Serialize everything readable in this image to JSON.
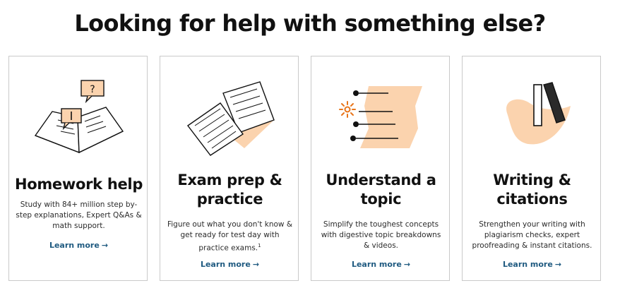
{
  "page": {
    "title": "Looking for help with something else?"
  },
  "cards": [
    {
      "title": "Homework help",
      "description": "Study with 84+ million step by-step explanations, Expert Q&As & math support.",
      "link": "Learn more",
      "icon": "open-book-question-icon"
    },
    {
      "title": "Exam prep & practice",
      "description": "Figure out what you don't know & get ready for test day with practice exams.",
      "footnote": "1",
      "link": "Learn more",
      "icon": "exam-papers-icon"
    },
    {
      "title": "Understand a topic",
      "description": "Simplify the toughest concepts with digestive topic breakdowns & videos.",
      "link": "Learn more",
      "icon": "topic-list-icon"
    },
    {
      "title": "Writing & citations",
      "description": "Strengthen your writing with plagiarism checks, expert proofreading & instant citations.",
      "link": "Learn more",
      "icon": "writing-books-icon"
    }
  ],
  "arrow_glyph": "→",
  "colors": {
    "accent_peach": "#fbd3ae",
    "link": "#1f5a80",
    "spark": "#e8751a",
    "ink": "#111111"
  }
}
